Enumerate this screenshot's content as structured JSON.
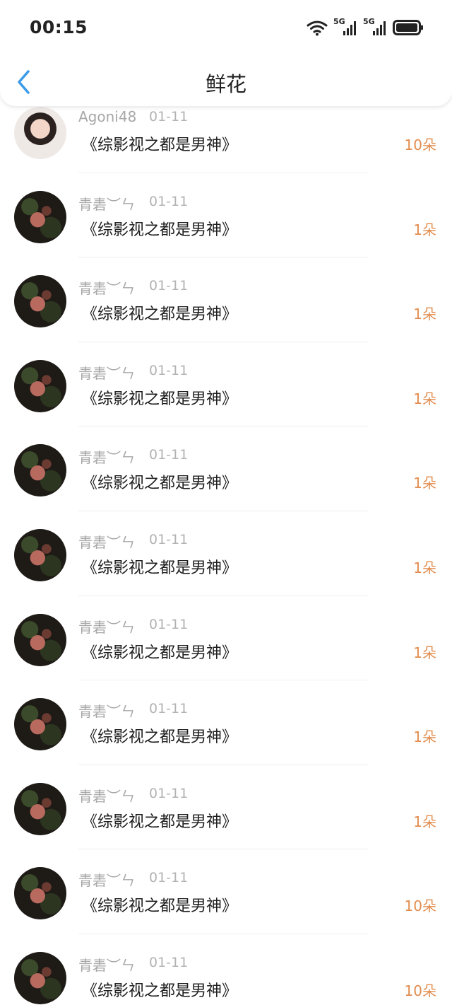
{
  "status_bar": {
    "time": "00:15",
    "icons": [
      "wifi-icon",
      "5g-signal-icon",
      "5g-signal-icon",
      "battery-icon"
    ],
    "network_label_1": "5G",
    "network_label_2": "5G"
  },
  "header": {
    "title": "鲜花",
    "back_icon": "chevron-left-icon",
    "accent_color": "#3b9be8"
  },
  "colors": {
    "amount": "#e38d4e",
    "meta": "#a8a8a8"
  },
  "records": [
    {
      "user": "Agoni48",
      "date": "01-11",
      "book": "《综影视之都是男神》",
      "amount": "10朵",
      "avatar": "girl"
    },
    {
      "user": "青砉︶ㄣ",
      "date": "01-11",
      "book": "《综影视之都是男神》",
      "amount": "1朵",
      "avatar": "dark"
    },
    {
      "user": "青砉︶ㄣ",
      "date": "01-11",
      "book": "《综影视之都是男神》",
      "amount": "1朵",
      "avatar": "dark"
    },
    {
      "user": "青砉︶ㄣ",
      "date": "01-11",
      "book": "《综影视之都是男神》",
      "amount": "1朵",
      "avatar": "dark"
    },
    {
      "user": "青砉︶ㄣ",
      "date": "01-11",
      "book": "《综影视之都是男神》",
      "amount": "1朵",
      "avatar": "dark"
    },
    {
      "user": "青砉︶ㄣ",
      "date": "01-11",
      "book": "《综影视之都是男神》",
      "amount": "1朵",
      "avatar": "dark"
    },
    {
      "user": "青砉︶ㄣ",
      "date": "01-11",
      "book": "《综影视之都是男神》",
      "amount": "1朵",
      "avatar": "dark"
    },
    {
      "user": "青砉︶ㄣ",
      "date": "01-11",
      "book": "《综影视之都是男神》",
      "amount": "1朵",
      "avatar": "dark"
    },
    {
      "user": "青砉︶ㄣ",
      "date": "01-11",
      "book": "《综影视之都是男神》",
      "amount": "1朵",
      "avatar": "dark"
    },
    {
      "user": "青砉︶ㄣ",
      "date": "01-11",
      "book": "《综影视之都是男神》",
      "amount": "10朵",
      "avatar": "dark"
    },
    {
      "user": "青砉︶ㄣ",
      "date": "01-11",
      "book": "《综影视之都是男神》",
      "amount": "10朵",
      "avatar": "dark"
    }
  ]
}
